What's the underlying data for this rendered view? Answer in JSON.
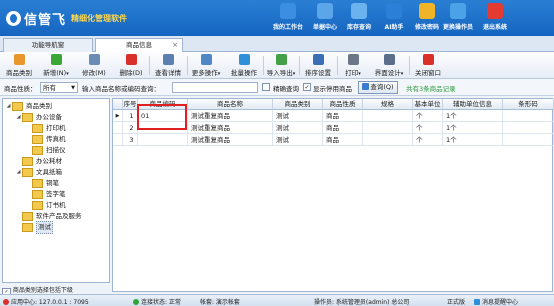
{
  "app": {
    "brand": "信管飞",
    "slogan": "精细化管理软件"
  },
  "header_buttons": [
    {
      "label": "我的工作台",
      "icon": "monitor-icon"
    },
    {
      "label": "单据中心",
      "icon": "document-icon"
    },
    {
      "label": "库存查询",
      "icon": "warehouse-icon"
    },
    {
      "label": "AI助手",
      "icon": "info-icon"
    },
    {
      "label": "修改密码",
      "icon": "lock-icon"
    },
    {
      "label": "更换操作员",
      "icon": "users-icon"
    },
    {
      "label": "退出系统",
      "icon": "exit-icon"
    }
  ],
  "tabs": [
    {
      "label": "功能导航窗"
    },
    {
      "label": "商品信息",
      "close": "×"
    }
  ],
  "toolbar": [
    {
      "label": "商品类别",
      "icon": "category-icon",
      "color": "#e8962e"
    },
    {
      "label": "新增(N)",
      "icon": "add-icon",
      "color": "#3aa635",
      "arrow": "▾"
    },
    {
      "label": "修改(M)",
      "icon": "edit-icon",
      "color": "#6a8bb3"
    },
    {
      "label": "删除(D)",
      "icon": "delete-icon",
      "color": "#d9302a"
    },
    {
      "label": "查看详情",
      "icon": "detail-icon",
      "color": "#5a7fb0"
    },
    {
      "label": "更多操作",
      "icon": "more-icon",
      "color": "#4f86c6",
      "arrow": "▾"
    },
    {
      "label": "批量操作",
      "icon": "batch-icon",
      "color": "#2f8fd8"
    },
    {
      "label": "导入导出",
      "icon": "import-export-icon",
      "color": "#43a047",
      "arrow": "▾"
    },
    {
      "label": "排序设置",
      "icon": "sort-icon",
      "color": "#3a6fb5"
    },
    {
      "label": "打印",
      "icon": "print-icon",
      "color": "#6b7787",
      "arrow": "▾"
    },
    {
      "label": "界面设计",
      "icon": "design-icon",
      "color": "#5b6f8a",
      "arrow": "▾"
    },
    {
      "label": "关闭窗口",
      "icon": "close-window-icon",
      "color": "#d9302a"
    }
  ],
  "filter": {
    "status_label": "商品性质：",
    "status_value": "所有",
    "search_label": "输入商品名称或编码查询：",
    "search_value": "",
    "exact_label": "精确查询",
    "exact_checked": false,
    "show_disabled_label": "显示停用商品",
    "show_disabled_checked": true,
    "query_button": "查询(Q)",
    "record_count": "共有3条商品记录"
  },
  "tree": {
    "root": "商品类别",
    "nodes": [
      {
        "label": "办公设备",
        "level": 1,
        "expanded": true
      },
      {
        "label": "打印机",
        "level": 2
      },
      {
        "label": "传真机",
        "level": 2
      },
      {
        "label": "扫描仪",
        "level": 2
      },
      {
        "label": "办公耗材",
        "level": 1
      },
      {
        "label": "文具纸箱",
        "level": 1,
        "expanded": true
      },
      {
        "label": "铜笔",
        "level": 2
      },
      {
        "label": "签字笔",
        "level": 2
      },
      {
        "label": "订书机",
        "level": 2
      },
      {
        "label": "软件产品及服务",
        "level": 1
      },
      {
        "label": "测试",
        "level": 1,
        "selected": true
      }
    ],
    "footer_checkbox": "商品类别选择包括下级",
    "footer_checked": true
  },
  "grid": {
    "columns": [
      "序号",
      "商品编码",
      "商品名称",
      "商品类别",
      "商品性质",
      "规格",
      "基本单位",
      "辅助单位信息",
      "条形码"
    ],
    "rows": [
      {
        "indicator": "▶",
        "cells": [
          "1",
          "01",
          "测试重复商品",
          "测试",
          "商品",
          "",
          "个",
          "1个",
          ""
        ]
      },
      {
        "indicator": "",
        "cells": [
          "2",
          "",
          "测试重复商品",
          "测试",
          "商品",
          "",
          "个",
          "1个",
          ""
        ]
      },
      {
        "indicator": "",
        "cells": [
          "3",
          "",
          "测试重复商品",
          "测试",
          "商品",
          "",
          "个",
          "1个",
          ""
        ]
      }
    ]
  },
  "status": {
    "app_center": "应用中心: 127.0.0.1 : 7095",
    "connection": "连接状态: 正常",
    "account": "帐套: 演示帐套",
    "operator": "操作员: 系统管理员(admin) 总公司",
    "edition": "正式版",
    "extra": "消息提醒中心"
  },
  "colors": {
    "header": "#1e6fc8",
    "accent": "#2a7fd3",
    "highlight": "#e02020"
  }
}
